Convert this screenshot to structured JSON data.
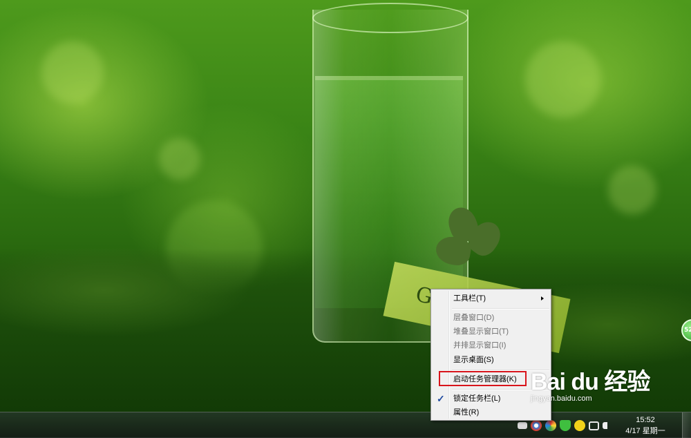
{
  "desktop": {
    "wallpaper_card_text": "G",
    "side_widget_text": "52"
  },
  "context_menu": {
    "items": [
      {
        "label": "工具栏(T)",
        "disabled": false,
        "submenu": true,
        "checked": false
      },
      {
        "label": "层叠窗口(D)",
        "disabled": true,
        "submenu": false,
        "checked": false
      },
      {
        "label": "堆叠显示窗口(T)",
        "disabled": true,
        "submenu": false,
        "checked": false
      },
      {
        "label": "并排显示窗口(I)",
        "disabled": true,
        "submenu": false,
        "checked": false
      },
      {
        "label": "显示桌面(S)",
        "disabled": false,
        "submenu": false,
        "checked": false
      },
      {
        "label": "启动任务管理器(K)",
        "disabled": false,
        "submenu": false,
        "checked": false,
        "highlighted": true
      },
      {
        "label": "锁定任务栏(L)",
        "disabled": false,
        "submenu": false,
        "checked": true
      },
      {
        "label": "属性(R)",
        "disabled": false,
        "submenu": false,
        "checked": false
      }
    ],
    "check_mark": "✓",
    "highlight_color": "#d8141b"
  },
  "taskbar": {
    "time": "15:52",
    "date": "4/17 星期一",
    "tray_icons": [
      "keyboard-icon",
      "browser-icon",
      "color-wheel-icon",
      "shield-icon",
      "plus-icon",
      "network-icon",
      "volume-icon"
    ]
  },
  "watermark": {
    "logo": "Bai du 经验",
    "url": "jingyan.baidu.com"
  }
}
